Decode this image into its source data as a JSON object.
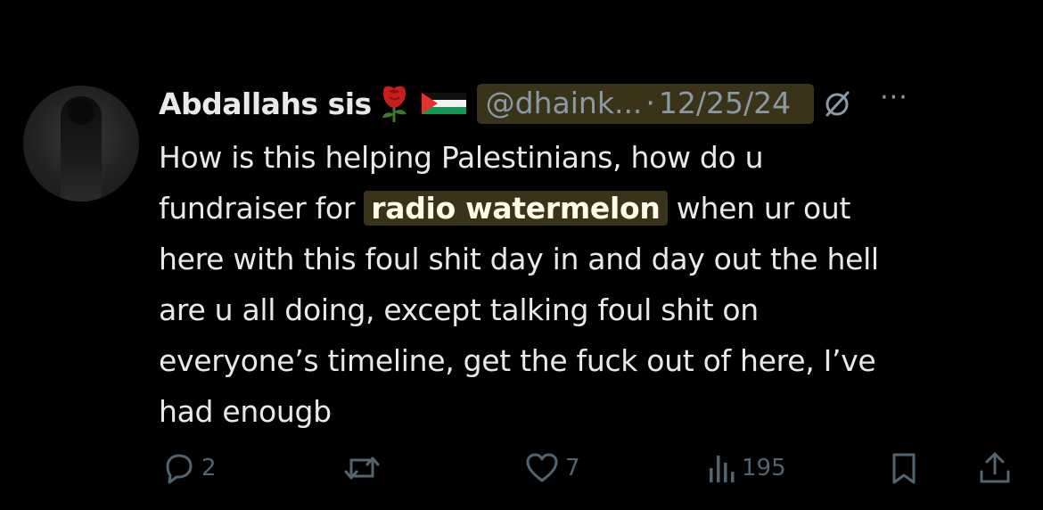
{
  "tweet": {
    "display_name": "Abdallahs sis",
    "handle": "@dhaink...",
    "separator": "·",
    "date": "12/25/24",
    "more_label": "···",
    "lines": [
      "How is this helping Palestinians, how do u",
      "fundraiser for",
      "radio watermelon",
      "when ur out",
      "here with this foul shit day in and day out the hell",
      "are u all doing, except talking foul shit on",
      "everyone’s timeline, get the fuck out of here, I’ve",
      "had enougb"
    ]
  },
  "actions": {
    "reply_count": "2",
    "like_count": "7",
    "views_count": "195"
  },
  "icons": {
    "rose": "rose-emoji",
    "flag": "palestine-flag-emoji",
    "grok": "grok-icon",
    "reply": "reply-icon",
    "retweet": "retweet-icon",
    "like": "heart-icon",
    "views": "views-icon",
    "bookmark": "bookmark-icon",
    "share": "share-icon"
  },
  "colors": {
    "background": "#000000",
    "text": "#e7e9ea",
    "muted": "#8b98a5",
    "action": "#536471",
    "highlight": "#3a3219"
  }
}
